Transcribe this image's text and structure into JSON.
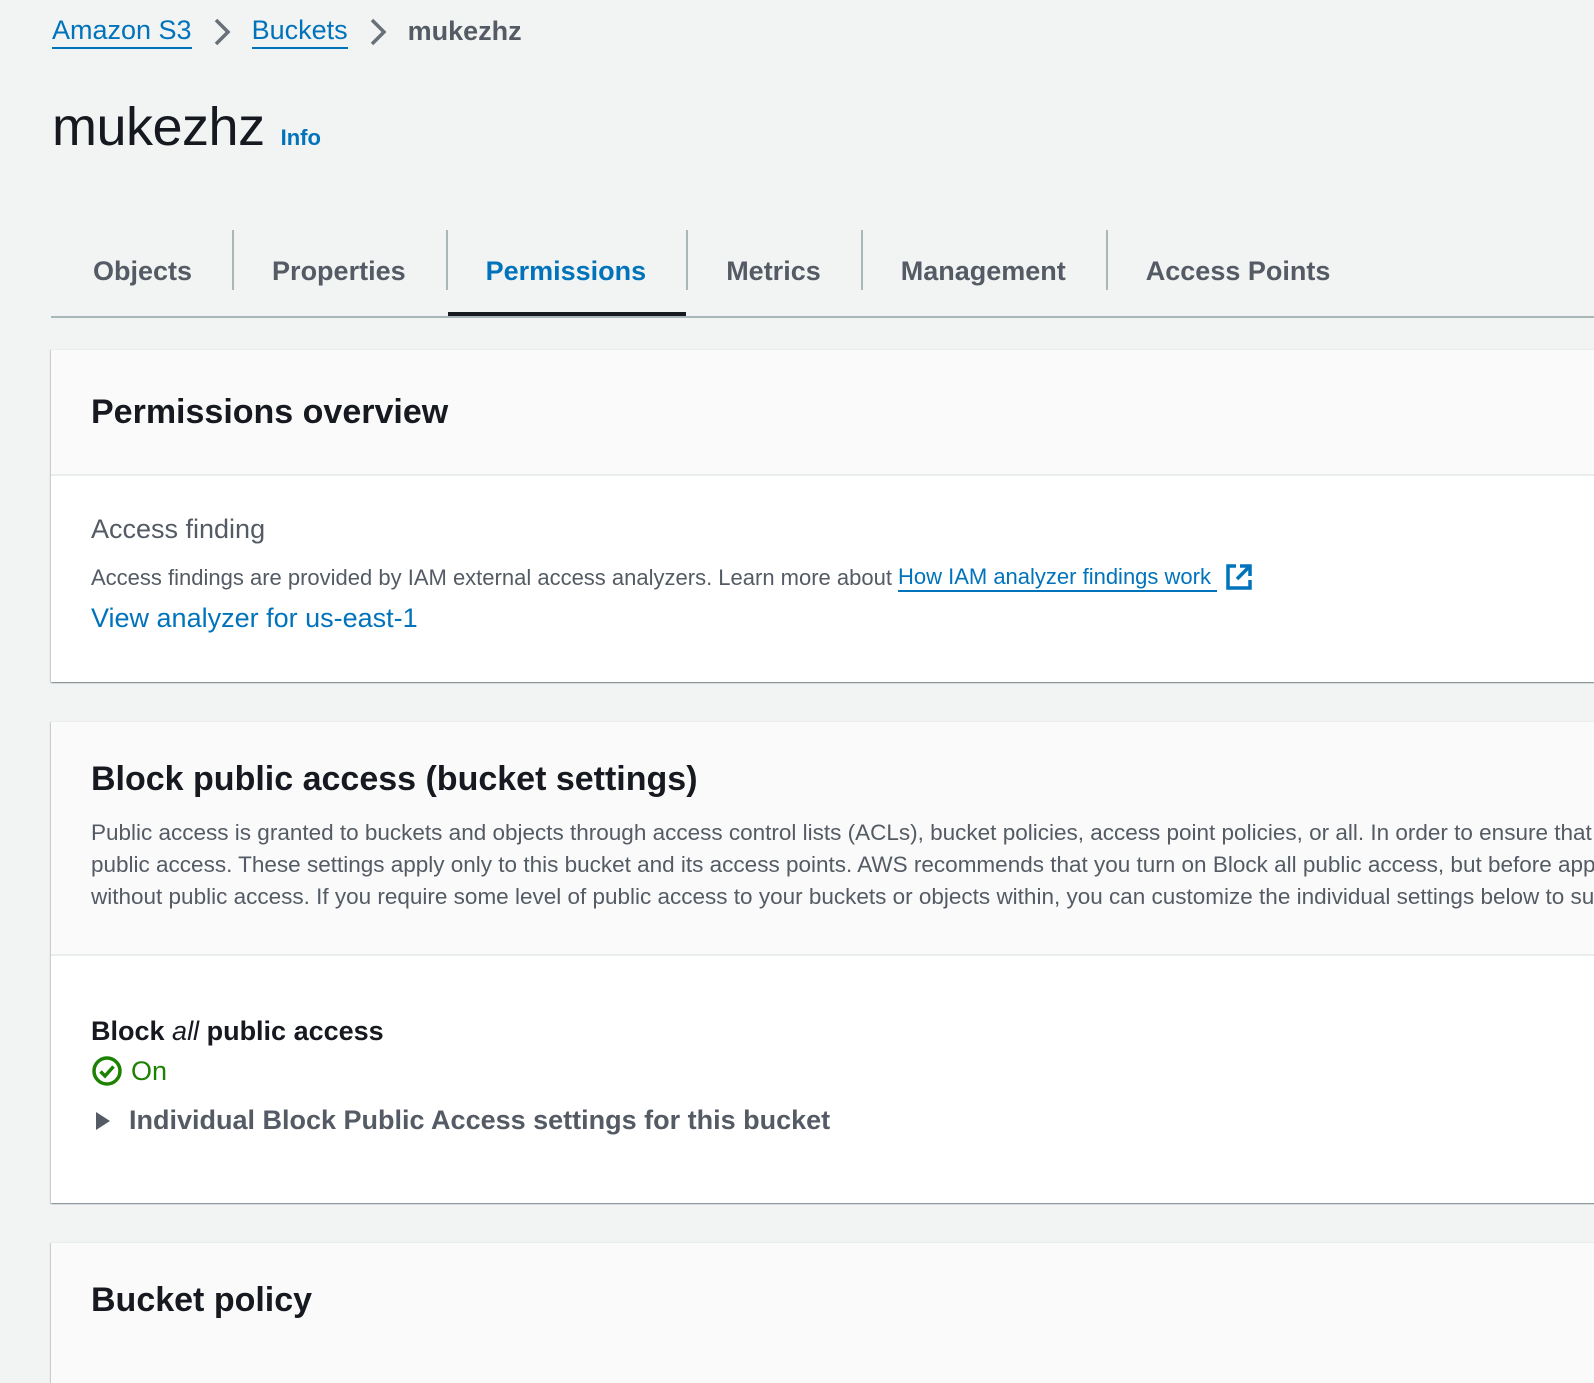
{
  "breadcrumb": {
    "items": [
      {
        "label": "Amazon S3"
      },
      {
        "label": "Buckets"
      }
    ],
    "current": "mukezhz"
  },
  "page": {
    "title": "mukezhz",
    "info_label": "Info"
  },
  "tabs": [
    {
      "label": "Objects",
      "active": false
    },
    {
      "label": "Properties",
      "active": false
    },
    {
      "label": "Permissions",
      "active": true
    },
    {
      "label": "Metrics",
      "active": false
    },
    {
      "label": "Management",
      "active": false
    },
    {
      "label": "Access Points",
      "active": false
    }
  ],
  "permissions_overview": {
    "title": "Permissions overview",
    "access_finding_label": "Access finding",
    "description": "Access findings are provided by IAM external access analyzers. Learn more about",
    "learn_more_link": "How IAM analyzer findings work",
    "view_analyzer_link": "View analyzer for us-east-1"
  },
  "block_public_access": {
    "title": "Block public access (bucket settings)",
    "description_lines": [
      "Public access is granted to buckets and objects through access control lists (ACLs), bucket policies, access point policies, or all. In order to ensure that public access to this bucket and its objects is blocked, turn on Block all",
      "public access. These settings apply only to this bucket and its access points. AWS recommends that you turn on Block all public access, but before applying any of these settings, ensure that your applications will work correctly",
      "without public access. If you require some level of public access to your buckets or objects within, you can customize the individual settings below to suit your specific storage use cases."
    ],
    "setting_label_prefix": "Block",
    "setting_label_emphasis": "all",
    "setting_label_suffix": "public access",
    "status": "On",
    "status_color": "#1d8102",
    "expander_label": "Individual Block Public Access settings for this bucket"
  },
  "bucket_policy": {
    "title": "Bucket policy"
  },
  "colors": {
    "link": "#0073bb",
    "background": "#f2f3f3",
    "text": "#16191f",
    "muted_text": "#545b64"
  }
}
